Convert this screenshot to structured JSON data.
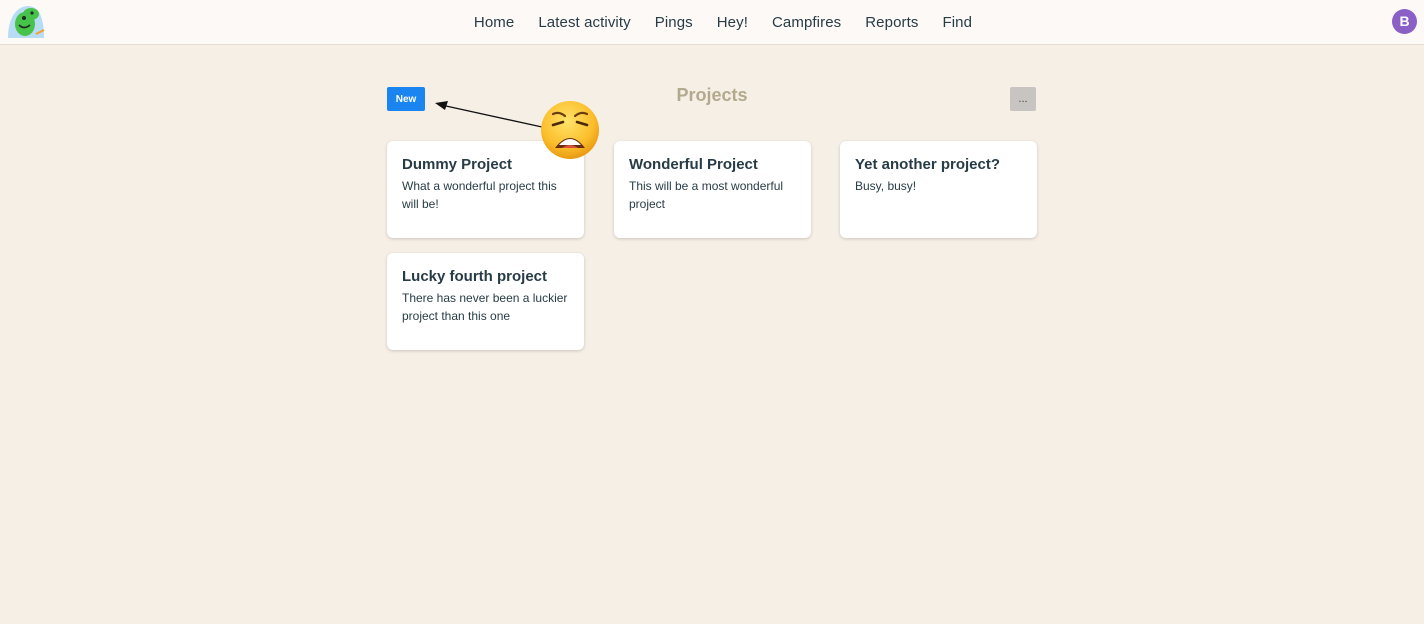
{
  "header": {
    "logo_icon": "campfire-mascot-icon",
    "nav": [
      "Home",
      "Latest activity",
      "Pings",
      "Hey!",
      "Campfires",
      "Reports",
      "Find"
    ],
    "avatar_initial": "B",
    "avatar_color": "#8a5fc6"
  },
  "toolbar": {
    "new_label": "New",
    "title": "Projects",
    "more_label": "..."
  },
  "projects": [
    {
      "name": "Dummy Project",
      "description": "What a wonderful project this will be!"
    },
    {
      "name": "Wonderful Project",
      "description": "This will be a most wonderful project"
    },
    {
      "name": "Yet another project?",
      "description": "Busy, busy!"
    },
    {
      "name": "Lucky fourth project",
      "description": "There has never been a luckier project than this one"
    }
  ],
  "annotation": {
    "emoji_icon": "weary-face-icon",
    "arrow_icon": "arrow-icon"
  },
  "colors": {
    "accent": "#1a84f0",
    "background": "#f6efe6",
    "title": "#b3a98e"
  }
}
